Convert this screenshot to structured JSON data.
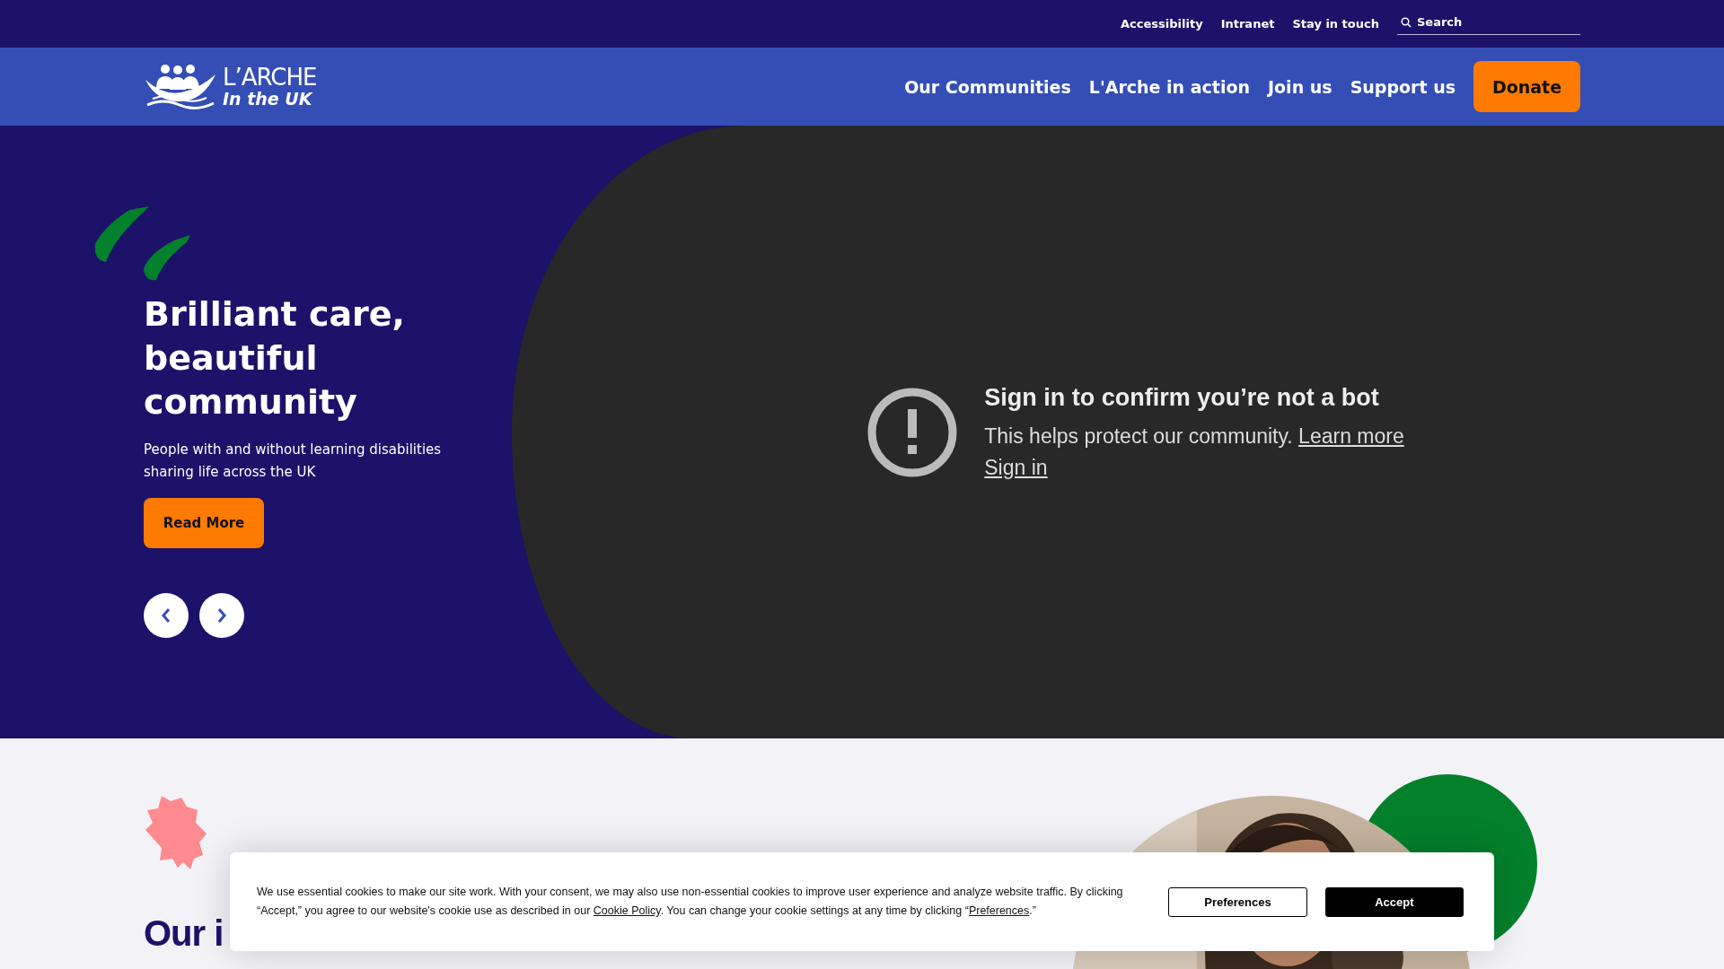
{
  "utility_links": [
    "Accessibility",
    "Intranet",
    "Stay in touch"
  ],
  "search": {
    "placeholder": "Search"
  },
  "logo": {
    "line_1": "L’ARCHE",
    "line_2": "In the UK"
  },
  "nav": [
    "Our Communities",
    "L'Arche in action",
    "Join us",
    "Support us"
  ],
  "donate_button": "Donate",
  "hero": {
    "heading": "Brilliant care, beautiful community",
    "subtitle": "People with and without learning disabilities sharing life across the UK",
    "button": "Read More"
  },
  "video": {
    "title": "Sign in to confirm you’re not a bot",
    "message": "This helps protect our community.",
    "learn_more": "Learn more",
    "sign_in": "Sign in"
  },
  "section": {
    "heading": "Our i"
  },
  "cookie_banner": {
    "text_before": "We use essential cookies to make our site work. With your consent, we may also use non-essential cookies to improve user experience and analyze website traffic. By clicking “Accept,” you agree to our website's cookie use as described in our ",
    "policy_link": "Cookie Policy",
    "text_middle": ". You can change your cookie settings at any time by clicking “",
    "preferences_link": "Preferences",
    "text_after": ".”",
    "buttons": [
      {
        "label": "Preferences",
        "kind": "outline"
      },
      {
        "label": "Accept",
        "kind": "solid"
      }
    ]
  }
}
